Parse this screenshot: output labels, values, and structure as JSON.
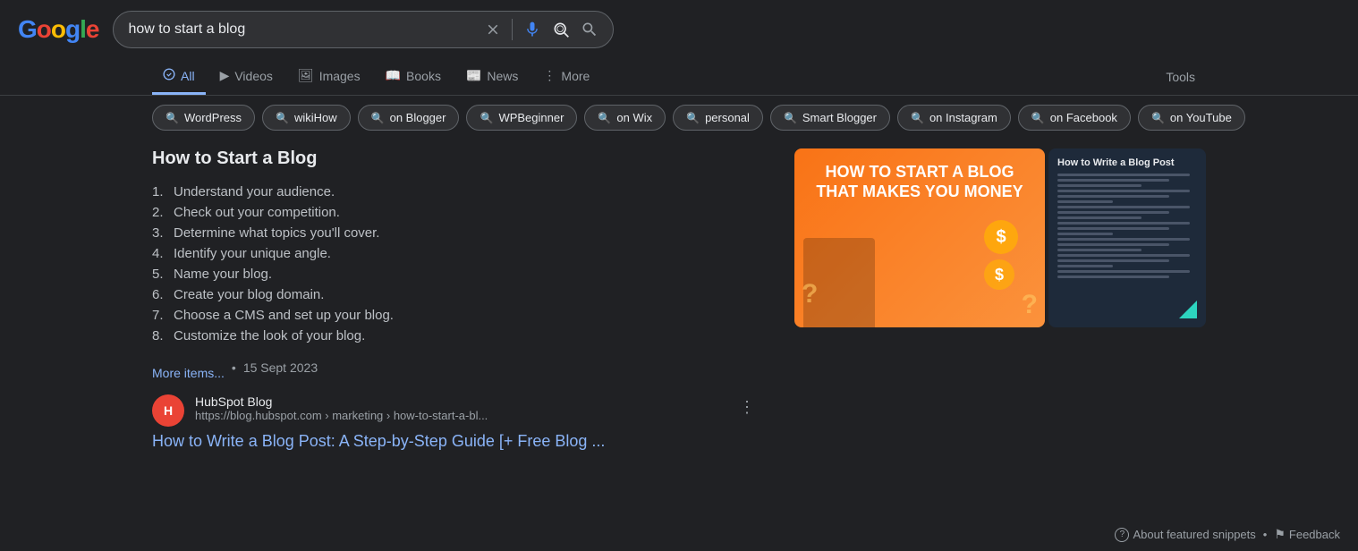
{
  "header": {
    "logo": "Google",
    "search_query": "how to start a blog"
  },
  "nav": {
    "tabs": [
      {
        "label": "All",
        "active": true,
        "icon": "🔍"
      },
      {
        "label": "Videos",
        "active": false,
        "icon": "▶"
      },
      {
        "label": "Images",
        "active": false,
        "icon": "🖼"
      },
      {
        "label": "Books",
        "active": false,
        "icon": "📖"
      },
      {
        "label": "News",
        "active": false,
        "icon": "📰"
      },
      {
        "label": "More",
        "active": false,
        "icon": "⋮"
      }
    ],
    "tools_label": "Tools"
  },
  "filters": {
    "chips": [
      "WordPress",
      "wikiHow",
      "on Blogger",
      "WPBeginner",
      "on Wix",
      "personal",
      "Smart Blogger",
      "on Instagram",
      "on Facebook",
      "on YouTube"
    ]
  },
  "snippet": {
    "title": "How to Start a Blog",
    "items": [
      "Understand your audience.",
      "Check out your competition.",
      "Determine what topics you'll cover.",
      "Identify your unique angle.",
      "Name your blog.",
      "Create your blog domain.",
      "Choose a CMS and set up your blog.",
      "Customize the look of your blog."
    ],
    "more_items_label": "More items...",
    "date": "15 Sept 2023"
  },
  "source": {
    "name": "HubSpot Blog",
    "url": "https://blog.hubspot.com › marketing › how-to-start-a-bl...",
    "favicon_letter": "H",
    "link_title": "How to Write a Blog Post: A Step-by-Step Guide [+ Free Blog ..."
  },
  "images": {
    "left": {
      "text": "HOW TO START A BLOG THAT MAKES YOU MONEY"
    },
    "right": {
      "title": "How to Write a Blog Post"
    }
  },
  "footer": {
    "about_snippets_label": "About featured snippets",
    "feedback_label": "Feedback",
    "question_icon": "?",
    "feedback_icon": "⚑"
  }
}
